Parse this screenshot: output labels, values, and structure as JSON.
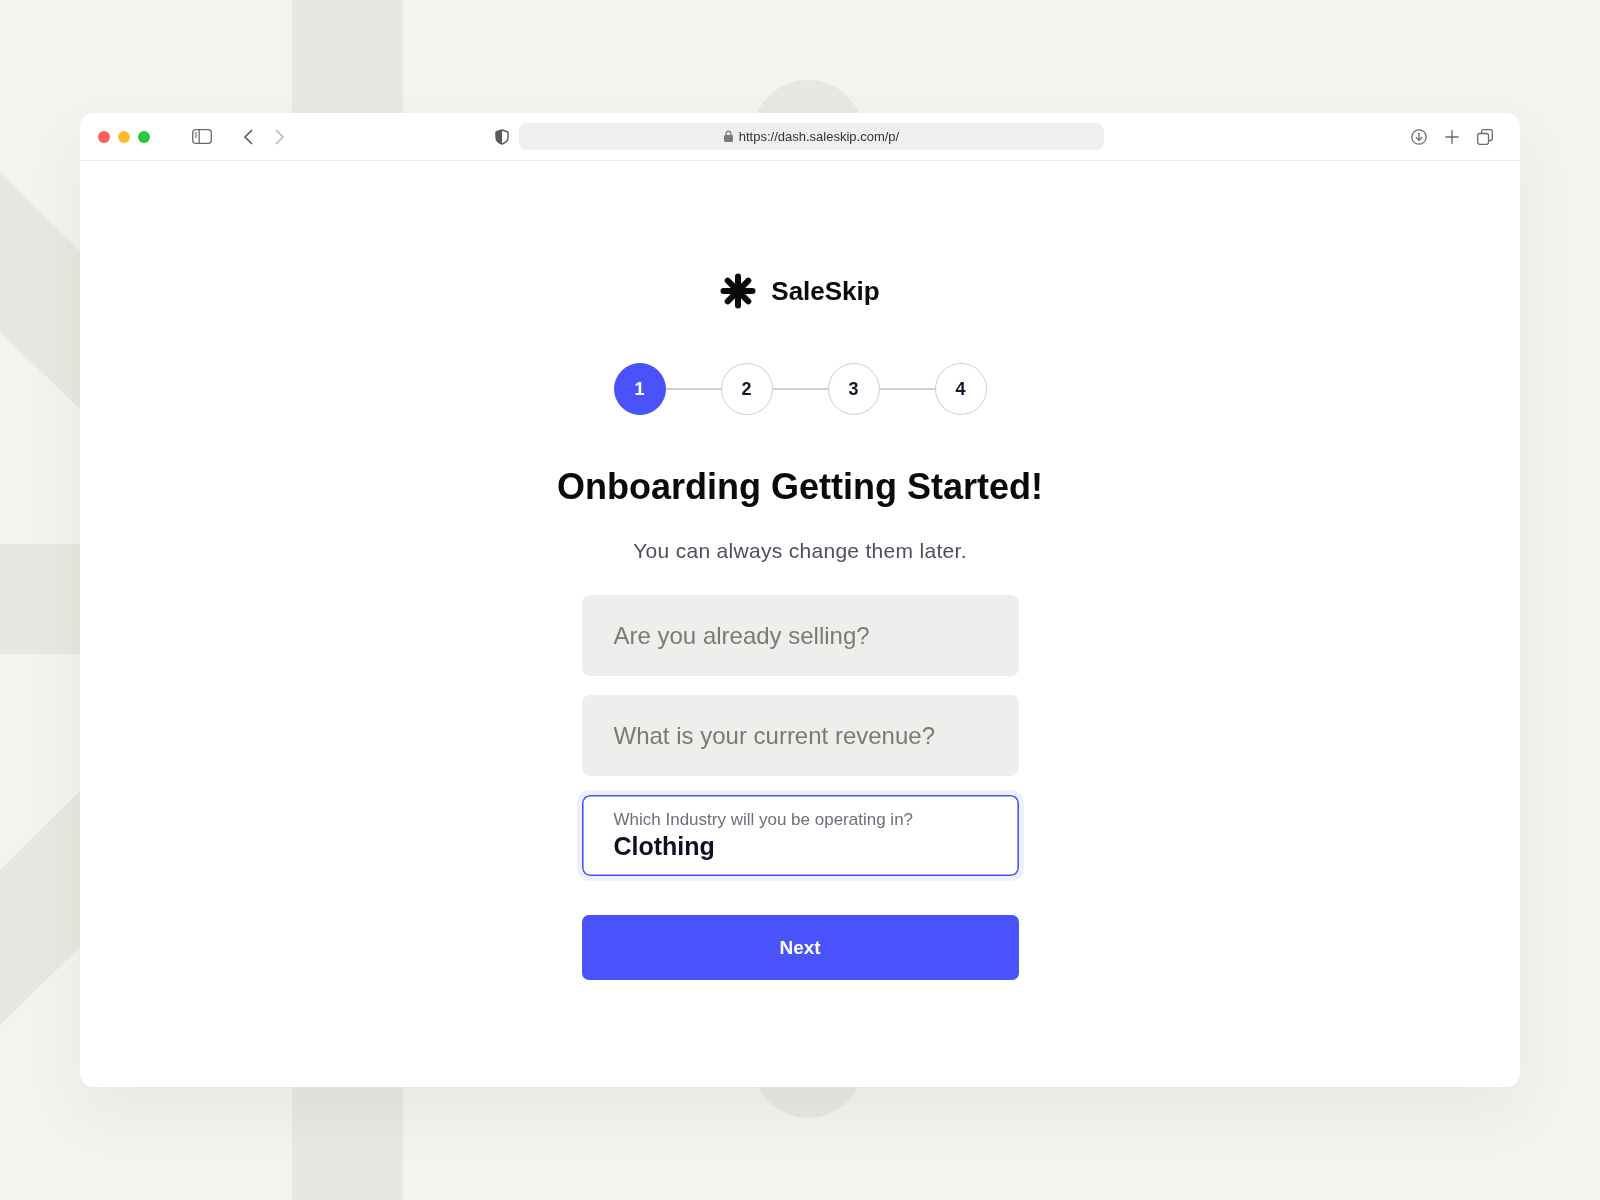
{
  "browser": {
    "nav_buttons": [
      {
        "kind": "back",
        "disabled": false
      },
      {
        "kind": "forward",
        "disabled": true
      }
    ],
    "url": "https://dash.saleskip.com/p/"
  },
  "brand": {
    "name": "SaleSkip"
  },
  "steps": [
    {
      "label": "1",
      "selected": true
    },
    {
      "label": "2",
      "selected": false
    },
    {
      "label": "3",
      "selected": false
    },
    {
      "label": "4",
      "selected": false
    }
  ],
  "heading": "Onboarding Getting Started!",
  "subtitle": "You can always change them later.",
  "fields": [
    {
      "kind": "placeholder",
      "placeholder": "Are you already selling?",
      "focused": false
    },
    {
      "kind": "placeholder",
      "placeholder": "What is your current revenue?",
      "focused": false
    },
    {
      "kind": "labeled",
      "label": "Which Industry will you be operating in?",
      "value": "Clothing",
      "focused": true
    }
  ],
  "next_button": {
    "label": "Next"
  }
}
